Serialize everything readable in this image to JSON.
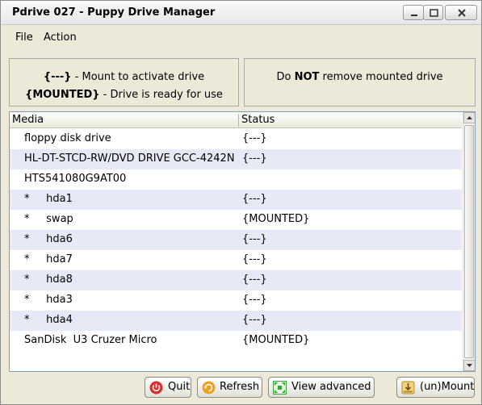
{
  "window": {
    "title": "Pdrive 027 - Puppy Drive Manager"
  },
  "menu": {
    "file": "File",
    "action": "Action"
  },
  "legend": {
    "unmounted_symbol": "{---}",
    "unmounted_text": " - Mount to activate drive",
    "mounted_symbol": "{MOUNTED}",
    "mounted_text": " - Drive is ready for use",
    "warning_prefix": "Do ",
    "warning_emphasis": "NOT",
    "warning_suffix": " remove mounted drive"
  },
  "list": {
    "columns": {
      "media": "Media",
      "status": "Status"
    },
    "rows": [
      {
        "media": "floppy disk drive",
        "status": "{---}"
      },
      {
        "media": "HL-DT-STCD-RW/DVD DRIVE GCC-4242N",
        "status": "{---}"
      },
      {
        "media": "HTS541080G9AT00",
        "status": ""
      },
      {
        "media": "*     hda1",
        "status": "{---}"
      },
      {
        "media": "*     swap",
        "status": "{MOUNTED}"
      },
      {
        "media": "*     hda6",
        "status": "{---}"
      },
      {
        "media": "*     hda7",
        "status": "{---}"
      },
      {
        "media": "*     hda8",
        "status": "{---}"
      },
      {
        "media": "*     hda3",
        "status": "{---}"
      },
      {
        "media": "*     hda4",
        "status": "{---}"
      },
      {
        "media": "SanDisk  U3 Cruzer Micro",
        "status": "{MOUNTED}"
      }
    ]
  },
  "buttons": {
    "quit": "Quit",
    "refresh": "Refresh",
    "view_advanced": "View advanced",
    "mount": "(un)Mount"
  },
  "colors": {
    "row_alt": "#e7eaf6",
    "quit_icon": "#d92f2f",
    "refresh_icon": "#f0a020",
    "advanced_icon": "#3aa33a"
  }
}
